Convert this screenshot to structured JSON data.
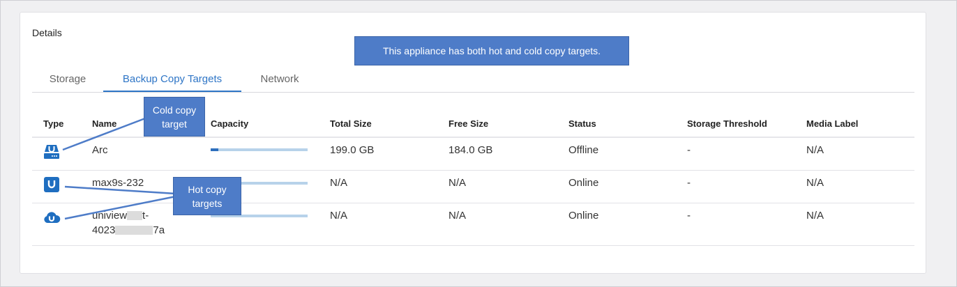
{
  "details": {
    "title": "Details",
    "tabs": [
      {
        "label": "Storage",
        "active": false
      },
      {
        "label": "Backup Copy Targets",
        "active": true
      },
      {
        "label": "Network",
        "active": false
      }
    ],
    "columns": [
      "Type",
      "Name",
      "Capacity",
      "Total Size",
      "Free Size",
      "Status",
      "Storage Threshold",
      "Media Label"
    ],
    "rows": [
      {
        "type_icon": "cold-storage-icon",
        "name": "Arc",
        "name_line2": "",
        "capacity_fraction": 0.08,
        "total_size": "199.0 GB",
        "free_size": "184.0 GB",
        "status": "Offline",
        "storage_threshold": "-",
        "media_label": "N/A"
      },
      {
        "type_icon": "appliance-u-icon",
        "name": "max9s-232",
        "name_line2": "",
        "capacity_fraction": 0.0,
        "total_size": "N/A",
        "free_size": "N/A",
        "status": "Online",
        "storage_threshold": "-",
        "media_label": "N/A"
      },
      {
        "type_icon": "cloud-u-icon",
        "name": "uniview",
        "name_suffix": "t-",
        "name_line2": "4023",
        "name_line2_suffix": "7a",
        "capacity_fraction": 0.0,
        "total_size": "N/A",
        "free_size": "N/A",
        "status": "Online",
        "storage_threshold": "-",
        "media_label": "N/A"
      }
    ]
  },
  "annotations": {
    "top_banner": "This appliance has both hot and cold copy targets.",
    "cold_callout_line1": "Cold copy",
    "cold_callout_line2": "target",
    "hot_callout_line1": "Hot copy",
    "hot_callout_line2": "targets"
  },
  "colors": {
    "accent": "#2e75c6",
    "callout_bg": "#4e7cc8",
    "capacity_track": "#b7d2ea",
    "capacity_fill": "#2e6fbd",
    "icon_blue": "#1f6ec0"
  }
}
